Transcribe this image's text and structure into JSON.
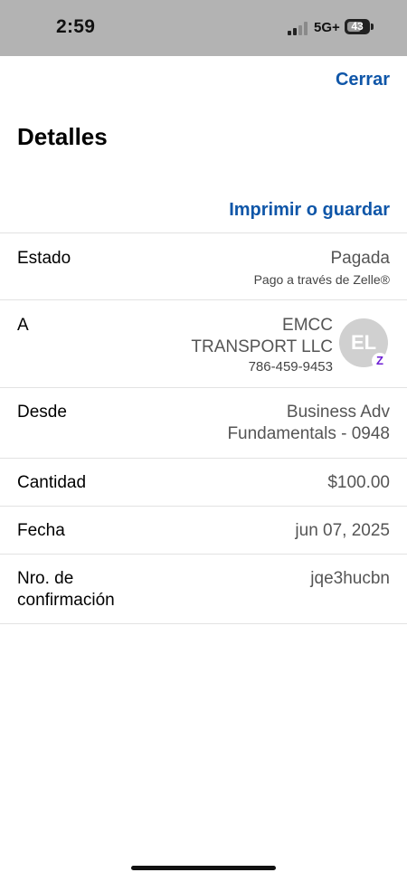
{
  "status_bar": {
    "time": "2:59",
    "network": "5G+",
    "battery": "43"
  },
  "header": {
    "close_label": "Cerrar",
    "title": "Detalles",
    "print_label": "Imprimir o guardar"
  },
  "details": {
    "status": {
      "label": "Estado",
      "value": "Pagada",
      "sub": "Pago a través de Zelle®"
    },
    "recipient": {
      "label": "A",
      "name_line1": "EMCC",
      "name_line2": "TRANSPORT LLC",
      "phone": "786-459-9453",
      "avatar_initials": "EL",
      "badge_letter": "Z"
    },
    "from": {
      "label": "Desde",
      "value_line1": "Business Adv",
      "value_line2": "Fundamentals - 0948"
    },
    "amount": {
      "label": "Cantidad",
      "value": "$100.00"
    },
    "date": {
      "label": "Fecha",
      "value": "jun 07, 2025"
    },
    "confirmation": {
      "label_line1": "Nro. de",
      "label_line2": "confirmación",
      "value": "jqe3hucbn"
    }
  },
  "colors": {
    "link": "#0f56a8",
    "zelle": "#6d1ed4",
    "status_bar_bg": "#b3b3b3"
  },
  "icons": {
    "signal": "cellular-signal-icon",
    "battery": "battery-icon",
    "zelle": "zelle-badge-icon"
  }
}
